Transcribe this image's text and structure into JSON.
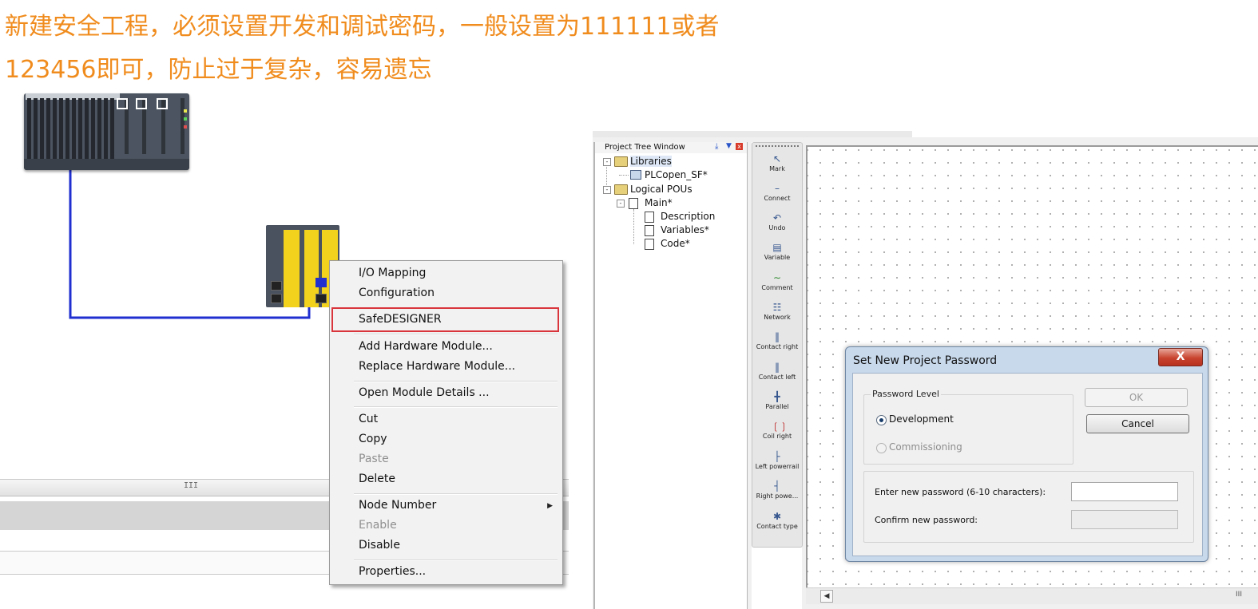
{
  "heading": {
    "line1": "新建安全工程，必须设置开发和调试密码，一般设置为111111或者",
    "line2": "123456即可，防止过于复杂，容易遗忘"
  },
  "context_menu": {
    "items": [
      {
        "label": "I/O Mapping",
        "enabled": true
      },
      {
        "label": "Configuration",
        "enabled": true
      },
      {
        "label": "SafeDESIGNER",
        "enabled": true,
        "highlighted": true
      },
      {
        "label": "Add Hardware Module...",
        "enabled": true
      },
      {
        "label": "Replace Hardware Module...",
        "enabled": true
      },
      {
        "label": "Open Module Details ...",
        "enabled": true
      },
      {
        "label": "Cut",
        "enabled": true
      },
      {
        "label": "Copy",
        "enabled": true
      },
      {
        "label": "Paste",
        "enabled": false
      },
      {
        "label": "Delete",
        "enabled": true
      },
      {
        "label": "Node Number",
        "enabled": true,
        "submenu": true
      },
      {
        "label": "Enable",
        "enabled": false
      },
      {
        "label": "Disable",
        "enabled": true
      },
      {
        "label": "Properties...",
        "enabled": true
      }
    ],
    "highlight_color": "#d9353c"
  },
  "project_tree": {
    "title": "Project Tree Window",
    "nodes": {
      "libraries": "Libraries",
      "plcopen": "PLCopen_SF*",
      "logical_pous": "Logical POUs",
      "main": "Main*",
      "description": "Description",
      "variables": "Variables*",
      "code": "Code*"
    }
  },
  "toolbox": {
    "items": [
      "Mark",
      "Connect",
      "Undo",
      "Variable",
      "Comment",
      "Network",
      "Contact right",
      "Contact left",
      "Parallel",
      "Coil right",
      "Left powerrail",
      "Right powe...",
      "Contact type"
    ]
  },
  "dialog": {
    "title": "Set New Project Password",
    "close_label": "X",
    "group_label": "Password Level",
    "radio_development": "Development",
    "radio_commissioning": "Commissioning",
    "selected": "Development",
    "ok_label": "OK",
    "cancel_label": "Cancel",
    "new_password_label": "Enter new password (6-10 characters):",
    "confirm_password_label": "Confirm new password:",
    "new_password_value": "",
    "confirm_password_value": ""
  },
  "colors": {
    "heading": "#f08c1e",
    "cable": "#1f2fd0",
    "module_yellow": "#f2d21d"
  }
}
